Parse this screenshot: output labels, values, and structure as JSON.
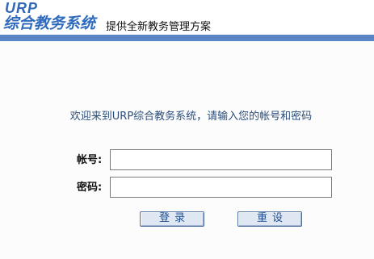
{
  "header": {
    "logo_top": "URP",
    "logo_main": "综合教务系统",
    "slogan": "提供全新教务管理方案"
  },
  "login": {
    "welcome": "欢迎来到URP综合教务系统，请输入您的帐号和密码",
    "account_label": "帐号:",
    "account_value": "",
    "password_label": "密码:",
    "password_value": "",
    "login_button": "登录",
    "reset_button": "重设"
  },
  "colors": {
    "brand_blue": "#2f6bbd",
    "bar_blue": "#5b86c6",
    "text_blue": "#2a4d7a"
  }
}
